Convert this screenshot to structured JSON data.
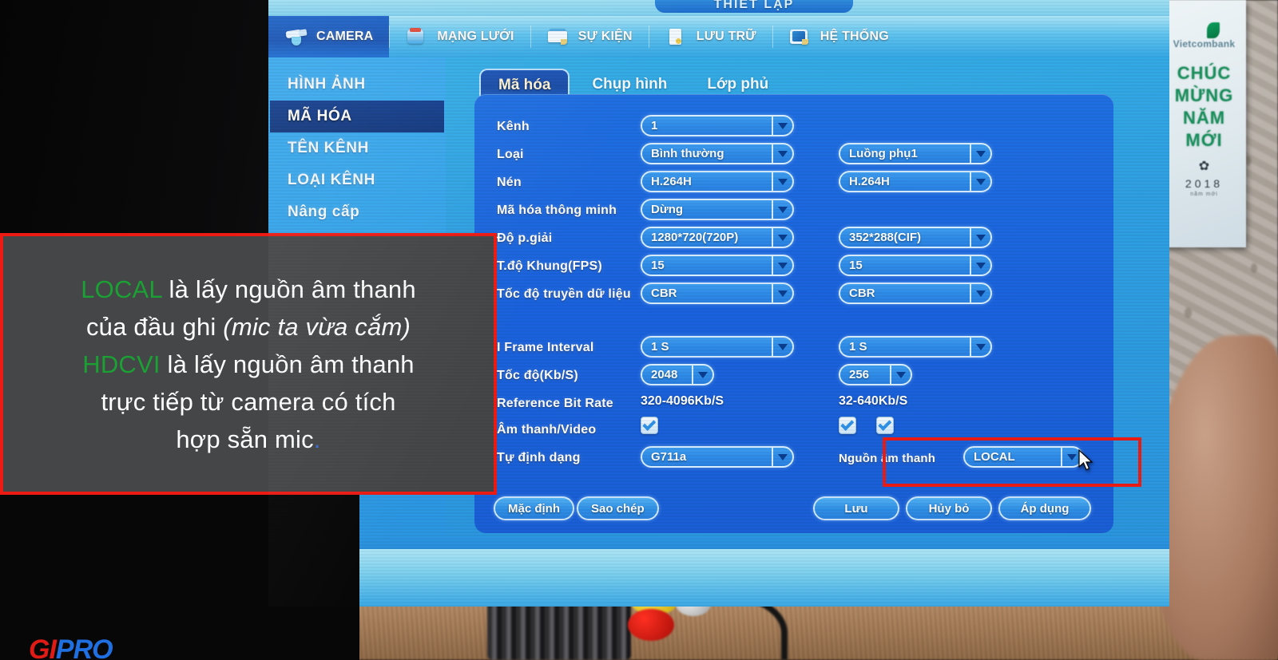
{
  "window": {
    "title": "THIẾT LẬP"
  },
  "menubar": {
    "items": [
      {
        "label": "CAMERA",
        "icon": "camera-icon",
        "active": true
      },
      {
        "label": "MẠNG LƯỚI",
        "icon": "network-icon",
        "active": false
      },
      {
        "label": "SỰ KIỆN",
        "icon": "event-icon",
        "active": false
      },
      {
        "label": "LƯU TRỮ",
        "icon": "storage-icon",
        "active": false
      },
      {
        "label": "HỆ THỐNG",
        "icon": "system-icon",
        "active": false
      }
    ]
  },
  "sidebar": {
    "items": [
      {
        "label": "HÌNH ẢNH",
        "active": false
      },
      {
        "label": "MÃ HÓA",
        "active": true
      },
      {
        "label": "TÊN KÊNH",
        "active": false
      },
      {
        "label": "LOẠI KÊNH",
        "active": false
      },
      {
        "label": "Nâng cấp",
        "active": false
      }
    ]
  },
  "tabs": [
    {
      "label": "Mã hóa",
      "active": true
    },
    {
      "label": "Chụp hình",
      "active": false
    },
    {
      "label": "Lớp phủ",
      "active": false
    }
  ],
  "form": {
    "labels": {
      "channel": "Kênh",
      "type": "Loại",
      "compression": "Nén",
      "smart_codec": "Mã hóa thông minh",
      "resolution": "Độ p.giải",
      "framerate": "T.độ Khung(FPS)",
      "bitrate_type": "Tốc độ truyền dữ liệu",
      "i_frame_interval": "I Frame Interval",
      "bitrate": "Tốc độ(Kb/S)",
      "reference_bit_rate": "Reference Bit Rate",
      "audio_video": "Âm thanh/Video",
      "audio_format": "Tự định dạng",
      "audio_source": "Nguồn âm thanh"
    },
    "main_stream": {
      "channel": "1",
      "type": "Bình thường",
      "compression": "H.264H",
      "smart_codec": "Dừng",
      "resolution": "1280*720(720P)",
      "framerate": "15",
      "bitrate_type": "CBR",
      "i_frame_interval": "1 S",
      "bitrate": "2048",
      "reference_bit_rate": "320-4096Kb/S",
      "audio_video_checked": true,
      "audio_format": "G711a"
    },
    "sub_stream": {
      "type": "Luồng phụ1",
      "compression": "H.264H",
      "resolution": "352*288(CIF)",
      "framerate": "15",
      "bitrate_type": "CBR",
      "i_frame_interval": "1 S",
      "bitrate": "256",
      "reference_bit_rate": "32-640Kb/S",
      "video_checked": true,
      "audio_checked": true,
      "audio_source": "LOCAL"
    }
  },
  "buttons": {
    "left": [
      {
        "label": "Mặc định"
      },
      {
        "label": "Sao chép"
      }
    ],
    "right": [
      {
        "label": "Lưu"
      },
      {
        "label": "Hủy bỏ"
      },
      {
        "label": "Áp dụng"
      }
    ]
  },
  "ghost_window": {
    "rows": [
      "Tốc độ(Kb/S)",
      "Reference Bit Rate",
      "Âm thanh/Video",
      "Tự định dạng"
    ],
    "buttons": [
      "Mặc định",
      "Sao chép"
    ]
  },
  "overlay": {
    "line1_highlight": "LOCAL",
    "line1_rest": " là lấy nguồn âm thanh",
    "line2_a": "của đầu ghi ",
    "line2_italic": "(mic ta vừa cắm)",
    "line3_highlight": "HDCVI",
    "line3_rest": " là lấy nguồn âm thanh",
    "line4": "trực tiếp từ camera có tích",
    "line5": "hợp sẵn mic",
    "line5_dot": ".",
    "highlight_color": "#1aa033",
    "border_color": "#ee1b14",
    "background_color": "#444648"
  },
  "annotation": {
    "red_box_target": "Nguồn âm thanh",
    "color": "#ee1b14"
  },
  "poster": {
    "brand": "Vietcombank",
    "line1": "CHÚC",
    "line2": "MỪNG",
    "line3": "NĂM",
    "line4": "MỚI",
    "star": "✿",
    "year": "2018",
    "footer": "năm mới"
  },
  "watermark": {
    "part1": "GI",
    "part2": "PRO"
  },
  "colors": {
    "panel_blue": "#1a62dd",
    "sidebar_blue": "#2f9fe8",
    "active_menu": "#1854b5",
    "active_sidebar": "#12387f",
    "tab_active": "#1a4da8",
    "field_blue": "#2f8ce8",
    "field_border": "#d8eeff"
  }
}
